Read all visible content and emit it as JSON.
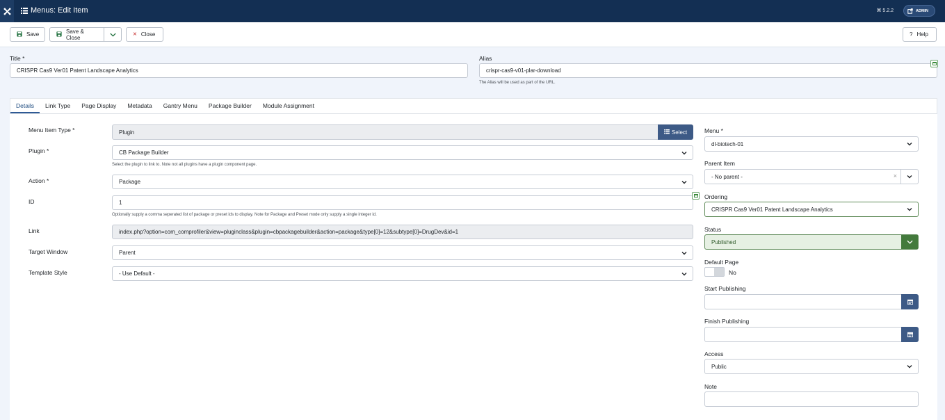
{
  "header": {
    "title": "Menus: Edit Item",
    "version": "5.2.2",
    "admin_label": "ADMIN",
    "brand_color": "#132f53"
  },
  "toolbar": {
    "save": "Save",
    "save_close": "Save & Close",
    "close": "Close",
    "help": "Help"
  },
  "form": {
    "title_label": "Title *",
    "title_value": "CRISPR Cas9 Ver01 Patent Landscape Analytics",
    "alias_label": "Alias",
    "alias_value": "crispr-cas9-v01-plar-download",
    "alias_help": "The Alias will be used as part of the URL."
  },
  "tabs": [
    "Details",
    "Link Type",
    "Page Display",
    "Metadata",
    "Gantry Menu",
    "Package Builder",
    "Module Assignment"
  ],
  "details": {
    "menu_item_type_label": "Menu Item Type *",
    "menu_item_type_value": "Plugin",
    "select_label": "Select",
    "plugin_label": "Plugin *",
    "plugin_value": "CB Package Builder",
    "plugin_help": "Select the plugin to link to. Note not all plugins have a plugin component page.",
    "action_label": "Action *",
    "action_value": "Package",
    "id_label": "ID",
    "id_value": "1",
    "id_help": "Optionally supply a comma seperated list of package or preset ids to display. Note for Package and Preset mode only supply a single integer id.",
    "link_label": "Link",
    "link_value": "index.php?option=com_comprofiler&view=pluginclass&plugin=cbpackagebuilder&action=package&type[0]=12&subtype[0]=DrugDev&id=1",
    "target_label": "Target Window",
    "target_value": "Parent",
    "template_label": "Template Style",
    "template_value": "- Use Default -"
  },
  "side": {
    "menu_label": "Menu *",
    "menu_value": "dl-biotech-01",
    "parent_label": "Parent Item",
    "parent_value": "- No parent -",
    "ordering_label": "Ordering",
    "ordering_value": "CRISPR Cas9 Ver01 Patent Landscape Analytics",
    "status_label": "Status",
    "status_value": "Published",
    "default_label": "Default Page",
    "default_value": "No",
    "start_label": "Start Publishing",
    "finish_label": "Finish Publishing",
    "access_label": "Access",
    "access_value": "Public",
    "note_label": "Note"
  }
}
